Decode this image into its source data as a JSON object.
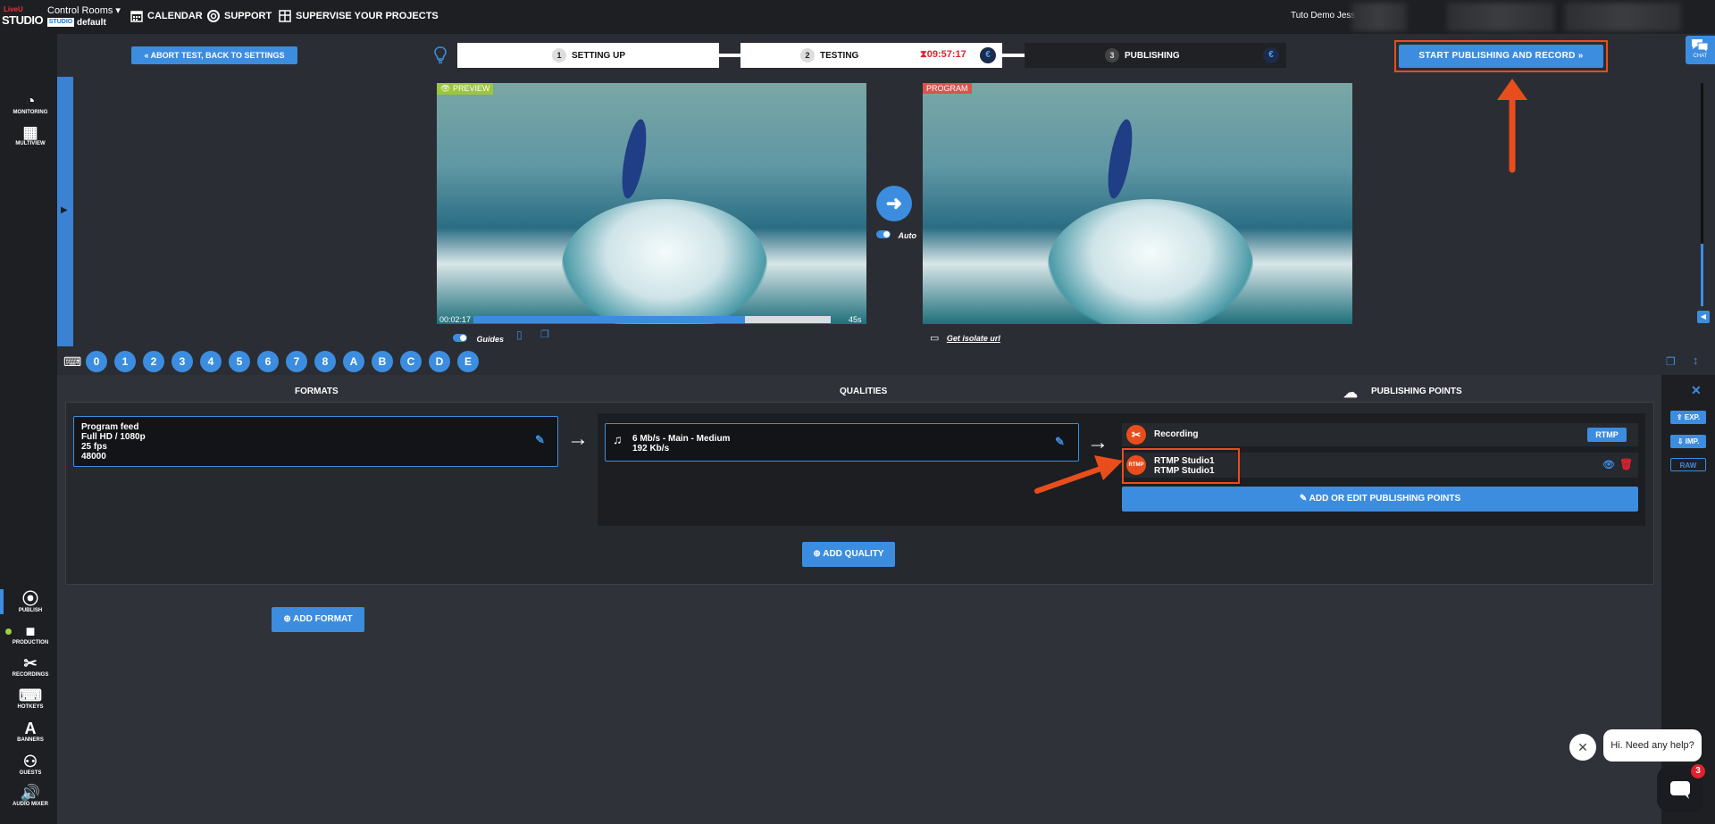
{
  "app": {
    "logo_top": "LiveU",
    "logo_bottom": "STUDIO",
    "control_rooms": "Control Rooms",
    "room_badge": "STUDIO",
    "room_name": "default"
  },
  "nav": {
    "calendar": "CALENDAR",
    "support": "SUPPORT",
    "supervise": "SUPERVISE YOUR PROJECTS",
    "user": "Tuto Demo Jessy"
  },
  "steps": {
    "abort": "ABORT TEST, BACK TO SETTINGS",
    "s1_num": "1",
    "s1_label": "SETTING UP",
    "s2_num": "2",
    "s2_label": "TESTING",
    "s2_timer": "09:57:17",
    "s3_num": "3",
    "s3_label": "PUBLISHING",
    "euro": "€",
    "start_button": "START PUBLISHING AND RECORD",
    "chat": "CHAT"
  },
  "sidebar_top": [
    {
      "label": "MONITORING"
    },
    {
      "label": "MULTIVIEW"
    }
  ],
  "sidebar_bottom": [
    {
      "label": "PUBLISH"
    },
    {
      "label": "PRODUCTION"
    },
    {
      "label": "RECORDINGS"
    },
    {
      "label": "HOTKEYS"
    },
    {
      "label": "BANNERS"
    },
    {
      "label": "GUESTS"
    },
    {
      "label": "AUDIO MIXER"
    }
  ],
  "preview": {
    "tag": "PREVIEW",
    "time_start": "00:02:17",
    "time_end": "45s",
    "progress_fraction": 0.76,
    "guides": "Guides"
  },
  "program": {
    "tag": "PROGRAM",
    "isolate": "Get isolate url"
  },
  "transition": {
    "auto": "Auto"
  },
  "hotkeys": [
    "0",
    "1",
    "2",
    "3",
    "4",
    "5",
    "6",
    "7",
    "8",
    "A",
    "B",
    "C",
    "D",
    "E"
  ],
  "panel": {
    "formats_title": "FORMATS",
    "qualities_title": "QUALITIES",
    "publishing_title": "PUBLISHING POINTS",
    "format_line1": "Program feed",
    "format_line2": "Full HD / 1080p",
    "format_line3": "25 fps",
    "format_line4": "48000",
    "quality_line1": "6 Mb/s - Main - Medium",
    "quality_line2": "192 Kb/s",
    "recording_label": "Recording",
    "recording_badge": "RTMP",
    "rtmp_icon": "RTMP",
    "rtmp_line1": "RTMP Studio1",
    "rtmp_line2": "RTMP Studio1",
    "add_edit": "ADD OR EDIT PUBLISHING POINTS",
    "add_quality": "ADD QUALITY",
    "add_format": "ADD FORMAT"
  },
  "right_rail": {
    "exp": "EXP.",
    "imp": "IMP.",
    "raw": "RAW"
  },
  "chat_widget": {
    "message": "Hi. Need any help?",
    "badge": "3"
  },
  "colors": {
    "accent": "#3c8ddf",
    "annotation": "#e84e1b",
    "timer": "#e0222e"
  }
}
